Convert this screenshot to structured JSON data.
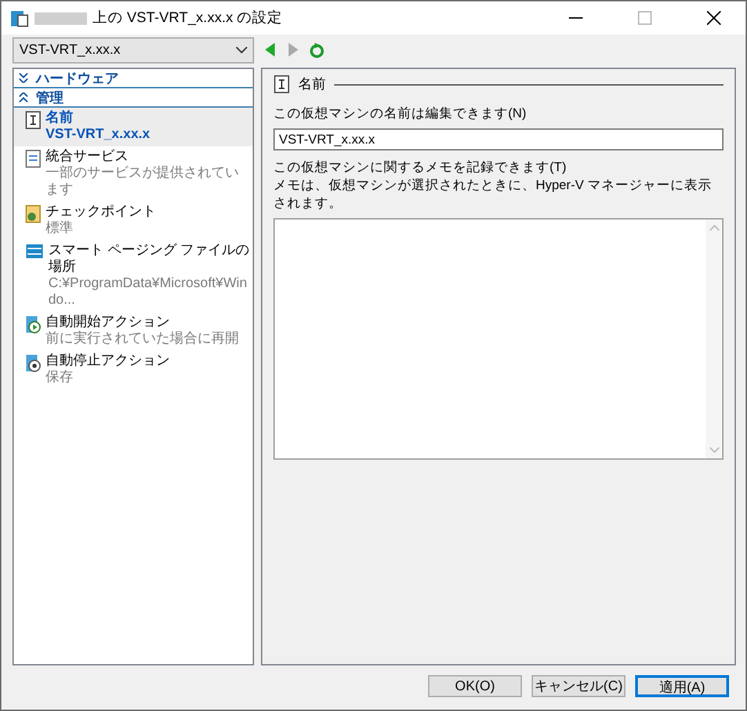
{
  "window": {
    "title": "上の VST-VRT_x.xx.x の設定"
  },
  "vm_selector": {
    "value": "VST-VRT_x.xx.x"
  },
  "sidebar": {
    "sections": [
      {
        "label": "ハードウェア",
        "expanded": false
      },
      {
        "label": "管理",
        "expanded": true,
        "items": [
          {
            "kind": "name",
            "title": "名前",
            "subtitle": "VST-VRT_x.xx.x",
            "selected": true
          },
          {
            "kind": "services",
            "title": "統合サービス",
            "subtitle": "一部のサービスが提供されています",
            "selected": false
          },
          {
            "kind": "checkpoint",
            "title": "チェックポイント",
            "subtitle": "標準",
            "selected": false
          },
          {
            "kind": "paging",
            "title": "スマート ページング ファイルの場所",
            "subtitle": "C:¥ProgramData¥Microsoft¥Windo...",
            "selected": false
          },
          {
            "kind": "start",
            "title": "自動開始アクション",
            "subtitle": "前に実行されていた場合に再開",
            "selected": false
          },
          {
            "kind": "stop",
            "title": "自動停止アクション",
            "subtitle": "保存",
            "selected": false
          }
        ]
      }
    ]
  },
  "panel": {
    "heading": "名前",
    "name_label": "この仮想マシンの名前は編集できます(N)",
    "name_value": "VST-VRT_x.xx.x",
    "notes_label": "この仮想マシンに関するメモを記録できます(T)",
    "notes_hint": "メモは、仮想マシンが選択されたときに、Hyper-V マネージャーに表示されます。"
  },
  "buttons": [
    {
      "label": "OK(O)",
      "default": false
    },
    {
      "label": "キャンセル(C)",
      "default": false
    },
    {
      "label": "適用(A)",
      "default": true
    }
  ]
}
